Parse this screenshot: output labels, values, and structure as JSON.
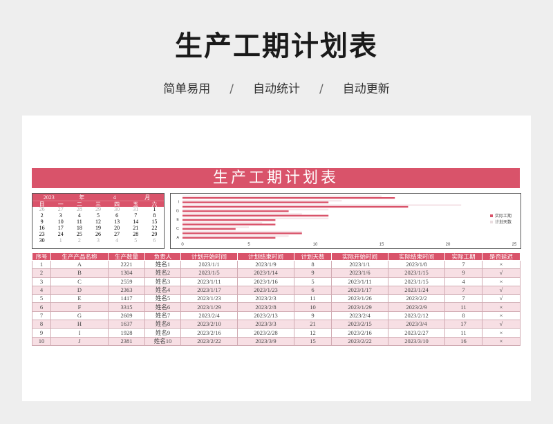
{
  "hero": {
    "title": "生产工期计划表",
    "sub1": "简单易用",
    "sub2": "自动统计",
    "sub3": "自动更新",
    "separator": "/"
  },
  "banner_title": "生产工期计划表",
  "calendar": {
    "year": "2023",
    "year_unit": "年",
    "month": "4",
    "month_unit": "月",
    "weekdays": [
      "日",
      "一",
      "二",
      "三",
      "四",
      "五",
      "六"
    ],
    "days": [
      {
        "d": "26",
        "o": true
      },
      {
        "d": "27",
        "o": true
      },
      {
        "d": "28",
        "o": true
      },
      {
        "d": "29",
        "o": true
      },
      {
        "d": "30",
        "o": true
      },
      {
        "d": "31",
        "o": true
      },
      {
        "d": "1",
        "o": false
      },
      {
        "d": "2",
        "o": false
      },
      {
        "d": "3",
        "o": false
      },
      {
        "d": "4",
        "o": false
      },
      {
        "d": "5",
        "o": false
      },
      {
        "d": "6",
        "o": false
      },
      {
        "d": "7",
        "o": false
      },
      {
        "d": "8",
        "o": false
      },
      {
        "d": "9",
        "o": false
      },
      {
        "d": "10",
        "o": false
      },
      {
        "d": "11",
        "o": false
      },
      {
        "d": "12",
        "o": false
      },
      {
        "d": "13",
        "o": false
      },
      {
        "d": "14",
        "o": false
      },
      {
        "d": "15",
        "o": false
      },
      {
        "d": "16",
        "o": false
      },
      {
        "d": "17",
        "o": false
      },
      {
        "d": "18",
        "o": false
      },
      {
        "d": "19",
        "o": false
      },
      {
        "d": "20",
        "o": false
      },
      {
        "d": "21",
        "o": false
      },
      {
        "d": "22",
        "o": false
      },
      {
        "d": "23",
        "o": false
      },
      {
        "d": "24",
        "o": false
      },
      {
        "d": "25",
        "o": false
      },
      {
        "d": "26",
        "o": false
      },
      {
        "d": "27",
        "o": false
      },
      {
        "d": "28",
        "o": false
      },
      {
        "d": "29",
        "o": false
      },
      {
        "d": "30",
        "o": false
      },
      {
        "d": "1",
        "o": true
      },
      {
        "d": "2",
        "o": true
      },
      {
        "d": "3",
        "o": true
      },
      {
        "d": "4",
        "o": true
      },
      {
        "d": "5",
        "o": true
      },
      {
        "d": "6",
        "o": true
      }
    ]
  },
  "chart_data": {
    "type": "bar",
    "orientation": "horizontal",
    "categories": [
      "A",
      "C",
      "E",
      "G",
      "I"
    ],
    "series": [
      {
        "name": "实际工期",
        "color": "#d9536a",
        "values": [
          7,
          4,
          7,
          7,
          11
        ]
      },
      {
        "name": "计划天数",
        "color": "#f6e6ea",
        "values": [
          8,
          5,
          9,
          11,
          12
        ]
      }
    ],
    "row_bars": [
      {
        "actual": 7,
        "plan": 8
      },
      {
        "actual": 9,
        "plan": 9
      },
      {
        "actual": 4,
        "plan": 5
      },
      {
        "actual": 7,
        "plan": 6
      },
      {
        "actual": 7,
        "plan": 11
      },
      {
        "actual": 11,
        "plan": 9
      },
      {
        "actual": 8,
        "plan": 11
      },
      {
        "actual": 17,
        "plan": 21
      },
      {
        "actual": 11,
        "plan": 12
      },
      {
        "actual": 16,
        "plan": 15
      }
    ],
    "xticks": [
      "0",
      "5",
      "10",
      "15",
      "20",
      "25"
    ],
    "xlim": [
      0,
      25
    ],
    "legend_position": "right"
  },
  "table": {
    "headers": [
      "序号",
      "生产产品名称",
      "生产数量",
      "负责人",
      "计划开始时间",
      "计划结束时间",
      "计划天数",
      "实际开始时间",
      "实际结束时间",
      "实际工期",
      "是否延迟"
    ],
    "rows": [
      [
        "1",
        "A",
        "2221",
        "姓名1",
        "2023/1/1",
        "2023/1/9",
        "8",
        "2023/1/1",
        "2023/1/8",
        "7",
        "×"
      ],
      [
        "2",
        "B",
        "1304",
        "姓名2",
        "2023/1/5",
        "2023/1/14",
        "9",
        "2023/1/6",
        "2023/1/15",
        "9",
        "√"
      ],
      [
        "3",
        "C",
        "2559",
        "姓名3",
        "2023/1/11",
        "2023/1/16",
        "5",
        "2023/1/11",
        "2023/1/15",
        "4",
        "×"
      ],
      [
        "4",
        "D",
        "2363",
        "姓名4",
        "2023/1/17",
        "2023/1/23",
        "6",
        "2023/1/17",
        "2023/1/24",
        "7",
        "√"
      ],
      [
        "5",
        "E",
        "1417",
        "姓名5",
        "2023/1/23",
        "2023/2/3",
        "11",
        "2023/1/26",
        "2023/2/2",
        "7",
        "√"
      ],
      [
        "6",
        "F",
        "3315",
        "姓名6",
        "2023/1/29",
        "2023/2/8",
        "10",
        "2023/1/29",
        "2023/2/9",
        "11",
        "×"
      ],
      [
        "7",
        "G",
        "2609",
        "姓名7",
        "2023/2/4",
        "2023/2/13",
        "9",
        "2023/2/4",
        "2023/2/12",
        "8",
        "×"
      ],
      [
        "8",
        "H",
        "1637",
        "姓名8",
        "2023/2/10",
        "2023/3/3",
        "21",
        "2023/2/15",
        "2023/3/4",
        "17",
        "√"
      ],
      [
        "9",
        "I",
        "1928",
        "姓名9",
        "2023/2/16",
        "2023/2/28",
        "12",
        "2023/2/16",
        "2023/2/27",
        "11",
        "×"
      ],
      [
        "10",
        "J",
        "2381",
        "姓名10",
        "2023/2/22",
        "2023/3/9",
        "15",
        "2023/2/22",
        "2023/3/10",
        "16",
        "×"
      ]
    ]
  }
}
